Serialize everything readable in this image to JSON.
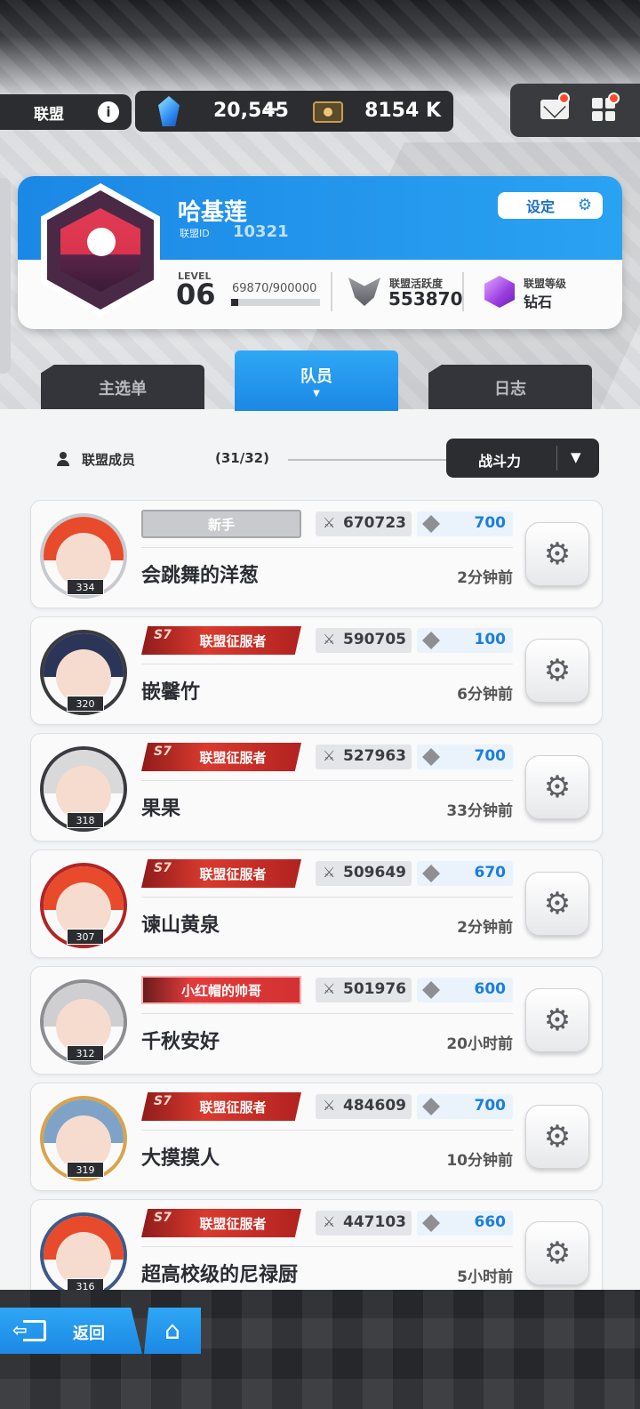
{
  "header": {
    "alliance_tab": "联盟",
    "info_icon": "info-icon",
    "crystal_value": "20,545",
    "plus": "+",
    "ticket_value": "8154 K"
  },
  "alliance": {
    "name": "哈基莲",
    "id_label": "联盟ID",
    "id": "10321",
    "settings_label": "设定",
    "level_label": "LEVEL",
    "level": "06",
    "exp_text": "69870/900000",
    "exp_fraction": 0.0776,
    "activity_label": "联盟活跃度",
    "activity_value": "553870",
    "rank_label": "联盟等级",
    "rank_value": "钻石"
  },
  "tabs": [
    {
      "label": "主选单",
      "active": false
    },
    {
      "label": "队员",
      "active": true
    },
    {
      "label": "日志",
      "active": false
    }
  ],
  "members_header": {
    "label": "联盟成员",
    "count": "(31/32)",
    "sort_label": "战斗力"
  },
  "members": [
    {
      "level": "334",
      "title": "新手",
      "title_type": "novice",
      "power": "670723",
      "contribution": "700",
      "name": "会跳舞的洋葱",
      "last_seen": "2分钟前",
      "hair": "#e84a2c",
      "frame": "#c9cacd"
    },
    {
      "level": "320",
      "title": "联盟征服者",
      "title_type": "conq",
      "power": "590705",
      "contribution": "100",
      "name": "嵌馨竹",
      "last_seen": "6分钟前",
      "hair": "#2a3558",
      "frame": "#3a3b3f"
    },
    {
      "level": "318",
      "title": "联盟征服者",
      "title_type": "conq",
      "power": "527963",
      "contribution": "700",
      "name": "果果",
      "last_seen": "33分钟前",
      "hair": "#d9d9d9",
      "frame": "#3a3b3f"
    },
    {
      "level": "307",
      "title": "联盟征服者",
      "title_type": "conq",
      "power": "509649",
      "contribution": "670",
      "name": "谏山黄泉",
      "last_seen": "2分钟前",
      "hair": "#e84a2c",
      "frame": "#b02525"
    },
    {
      "level": "312",
      "title": "小红帽的帅哥",
      "title_type": "red",
      "power": "501976",
      "contribution": "600",
      "name": "千秋安好",
      "last_seen": "20小时前",
      "hair": "#cfcfd2",
      "frame": "#8d8e92"
    },
    {
      "level": "319",
      "title": "联盟征服者",
      "title_type": "conq",
      "power": "484609",
      "contribution": "700",
      "name": "大摸摸人",
      "last_seen": "10分钟前",
      "hair": "#7fa2c8",
      "frame": "#d8a449"
    },
    {
      "level": "316",
      "title": "联盟征服者",
      "title_type": "conq",
      "power": "447103",
      "contribution": "660",
      "name": "超高校级的尼禄厨",
      "last_seen": "5小时前",
      "hair": "#e84a2c",
      "frame": "#3f5a86"
    }
  ],
  "footer": {
    "back_label": "返回",
    "home_icon": "home-icon"
  }
}
